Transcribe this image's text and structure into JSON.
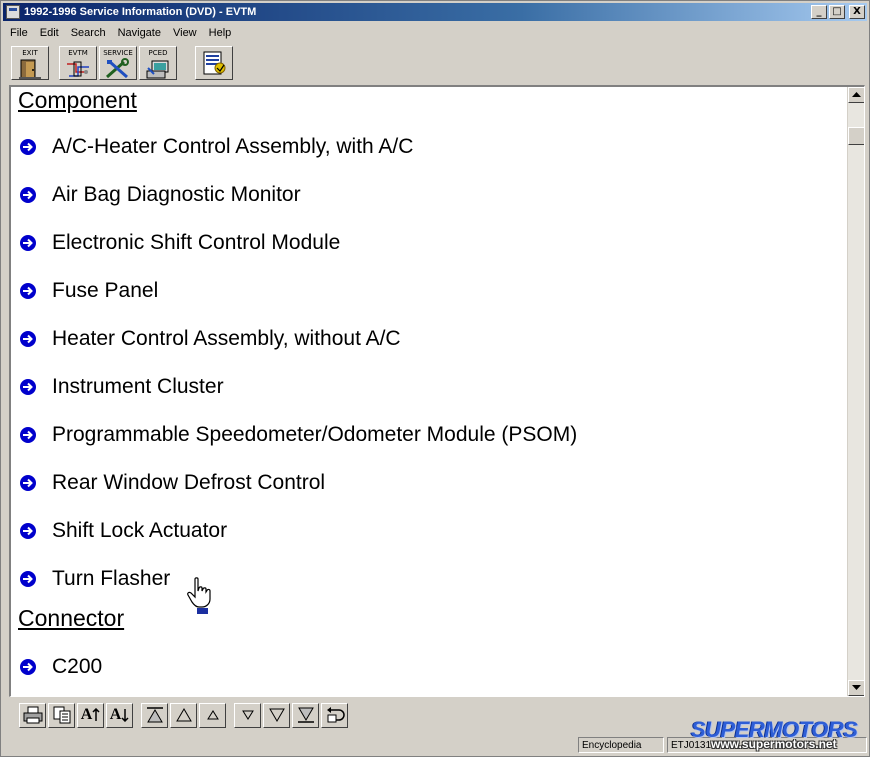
{
  "window": {
    "title": "1992-1996 Service Information (DVD) - EVTM",
    "controls": {
      "minimize": "_",
      "maximize": "□",
      "close": "X"
    }
  },
  "menu": [
    "File",
    "Edit",
    "Search",
    "Navigate",
    "View",
    "Help"
  ],
  "toolbar": {
    "buttons": [
      {
        "label": "EXIT",
        "icon": "exit-door-icon"
      },
      {
        "label": "EVTM",
        "icon": "wiring-diagram-icon"
      },
      {
        "label": "SERVICE",
        "icon": "tools-icon"
      },
      {
        "label": "PCED",
        "icon": "computer-icon"
      },
      {
        "label": "",
        "icon": "document-index-icon"
      }
    ]
  },
  "content": {
    "sections": [
      {
        "heading": "Component",
        "items": [
          "A/C-Heater Control Assembly, with A/C",
          "Air Bag Diagnostic Monitor",
          "Electronic Shift Control Module",
          "Fuse Panel",
          "Heater Control Assembly, without A/C",
          "Instrument Cluster",
          "Programmable Speedometer/Odometer Module (PSOM)",
          "Rear Window Defrost Control",
          "Shift Lock Actuator",
          "Turn Flasher"
        ]
      },
      {
        "heading": "Connector",
        "items": [
          "C200"
        ]
      }
    ],
    "bullet_color": "#0000cc"
  },
  "bottom_toolbar": {
    "buttons": [
      {
        "icon": "print-icon"
      },
      {
        "icon": "copy-icon"
      },
      {
        "label": "A",
        "icon": "font-increase-icon"
      },
      {
        "label": "A",
        "icon": "font-decrease-icon"
      },
      {
        "icon": "first-page-icon"
      },
      {
        "icon": "page-up-icon"
      },
      {
        "icon": "line-up-icon"
      },
      {
        "icon": "line-down-icon"
      },
      {
        "icon": "page-down-icon"
      },
      {
        "icon": "last-page-icon"
      },
      {
        "icon": "back-icon"
      }
    ]
  },
  "status": {
    "panel1": "Encyclopedia",
    "panel2": "ETJ01310"
  },
  "watermark": {
    "brand": "SUPERMOTORS",
    "url": "www.supermotors.net"
  }
}
